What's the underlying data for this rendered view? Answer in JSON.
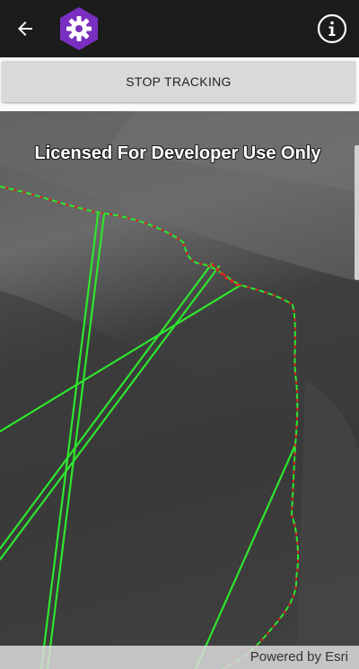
{
  "header": {
    "back_icon": "arrow-back-icon",
    "logo_icon": "gear-hexagon-logo-icon",
    "info_icon": "info-circle-icon",
    "logo_color": "#7a2fc0"
  },
  "toolbar": {
    "stop_label": "STOP TRACKING"
  },
  "map": {
    "license_text": "Licensed For Developer Use Only",
    "attribution": "Powered by Esri",
    "track_color": "#2ee62e",
    "boundary_colors": [
      "#2ee62e",
      "#e02020"
    ]
  }
}
